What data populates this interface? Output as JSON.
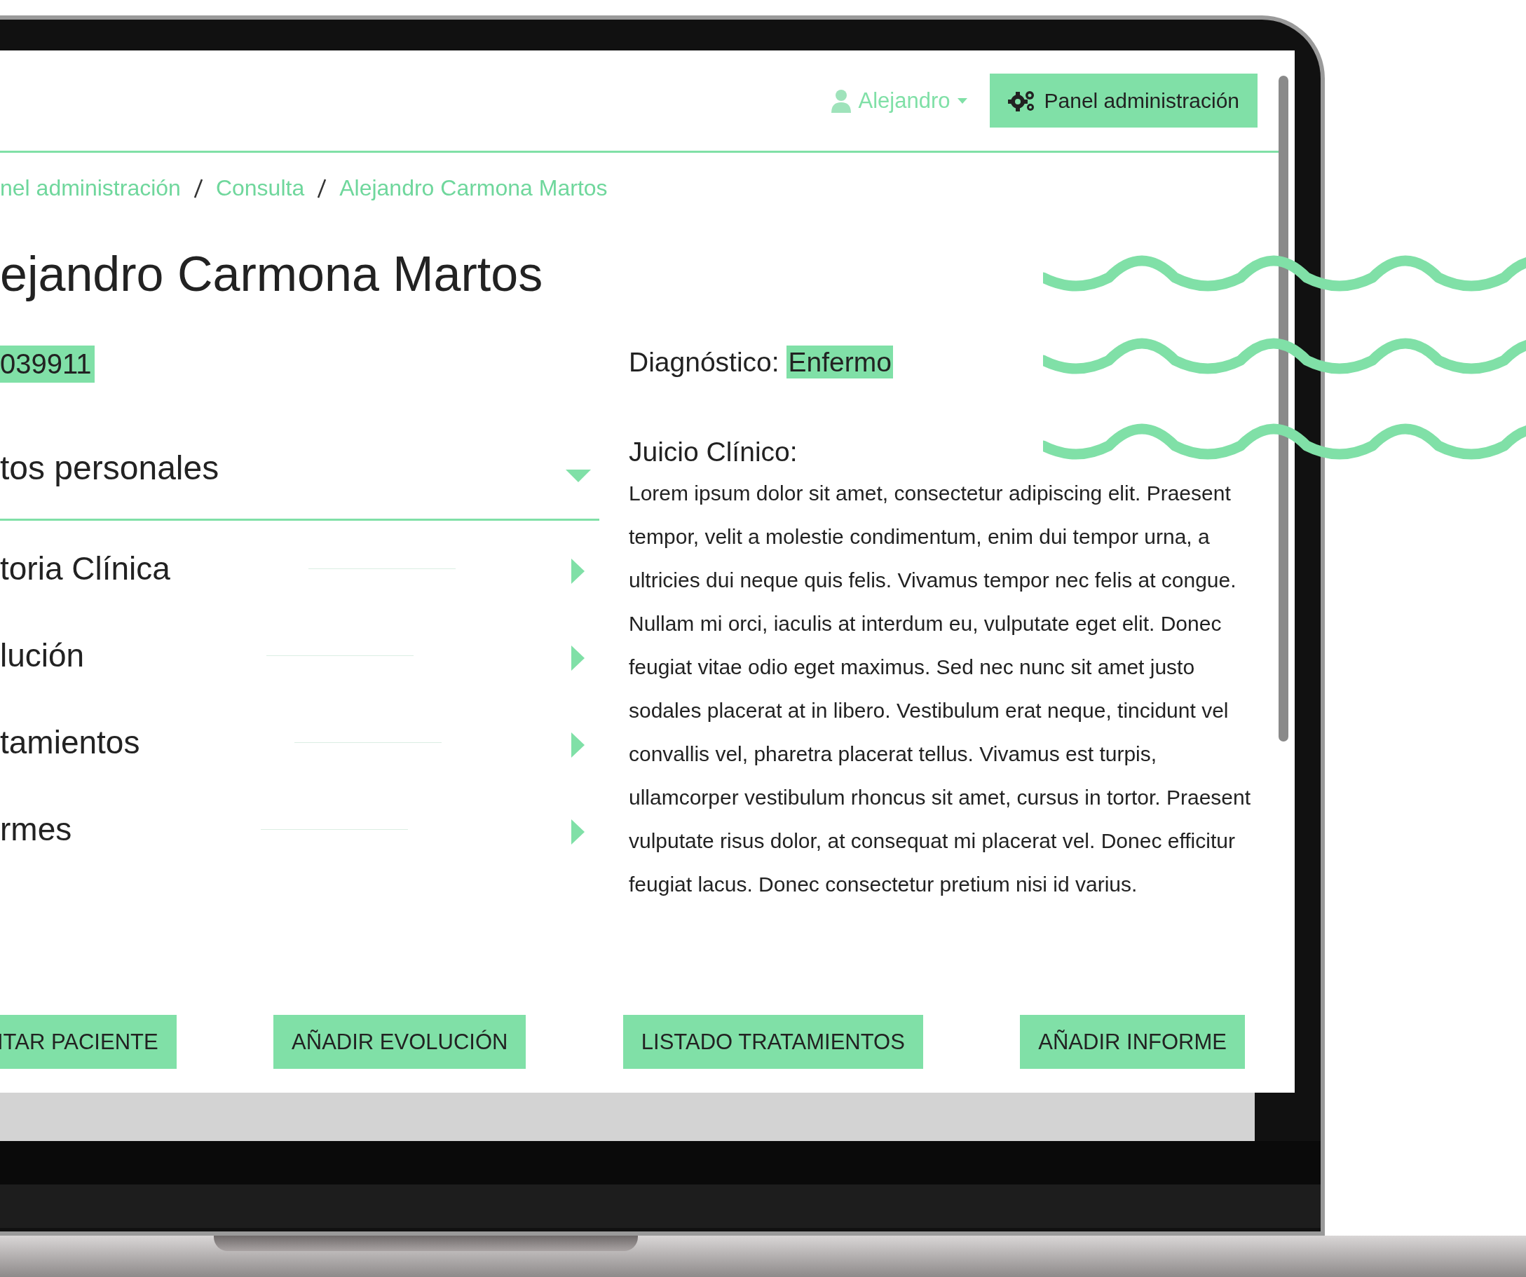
{
  "header": {
    "user": "Alejandro",
    "admin_button": "Panel administración"
  },
  "breadcrumb": [
    {
      "label": "nel administración"
    },
    {
      "label": "Consulta"
    },
    {
      "label": "Alejandro Carmona Martos"
    }
  ],
  "title": "ejandro Carmona Martos",
  "patient_id": "039911",
  "sections": [
    {
      "label": "tos personales",
      "expanded": true
    },
    {
      "label": "toria Clínica",
      "expanded": false
    },
    {
      "label": "lución",
      "expanded": false
    },
    {
      "label": "tamientos",
      "expanded": false
    },
    {
      "label": "rmes",
      "expanded": false
    }
  ],
  "diagnosis": {
    "label": "Diagnóstico:",
    "value": "Enfermo"
  },
  "clinical_judgment": {
    "label": "Juicio Clínico:",
    "text": "Lorem ipsum dolor sit amet, consectetur adipiscing elit. Praesent tempor, velit a molestie condimentum, enim dui tempor urna, a ultricies dui neque quis felis. Vivamus tempor nec felis at congue. Nullam mi orci, iaculis at interdum eu, vulputate eget elit. Donec feugiat vitae odio eget maximus. Sed nec nunc sit amet justo sodales placerat at in libero. Vestibulum erat neque, tincidunt vel convallis vel, pharetra placerat tellus. Vivamus est turpis, ullamcorper vestibulum rhoncus sit amet, cursus in tortor. Praesent vulputate risus dolor, at consequat mi placerat vel. Donec efficitur feugiat lacus. Donec consectetur pretium nisi id varius."
  },
  "buttons": [
    "ITAR PACIENTE",
    "AÑADIR EVOLUCIÓN",
    "LISTADO TRATAMIENTOS",
    "AÑADIR INFORME"
  ]
}
